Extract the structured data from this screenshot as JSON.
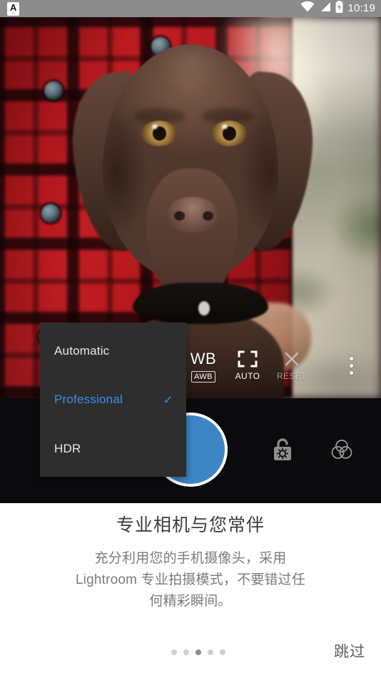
{
  "statusbar": {
    "app_badge_letter": "A",
    "app_badge_sub": "Lr",
    "clock": "10:19",
    "icons": [
      "wifi-icon",
      "cellular-signal-icon",
      "battery-charging-icon"
    ],
    "background_color": "#8c8c8c"
  },
  "camera": {
    "controls": [
      {
        "id": "wb",
        "main": "WB",
        "sub": "AWB",
        "sub_style": "badge",
        "dimmed": false
      },
      {
        "id": "focus",
        "main": "focus-frame-icon",
        "sub": "AUTO",
        "sub_style": "plain",
        "dimmed": false
      },
      {
        "id": "reset",
        "main": "close-x-icon",
        "sub": "RESET",
        "sub_style": "plain",
        "dimmed": true
      }
    ],
    "overflow_menu": "more-options-icon",
    "shutter": {
      "label": "shutter-button",
      "color": "#3d86c6",
      "ring_color": "#ffffff"
    },
    "bottom_icons": [
      {
        "id": "ae-lock",
        "name": "ae-lock-unlocked-icon"
      },
      {
        "id": "color-profile",
        "name": "color-circles-icon"
      }
    ],
    "bar_color": "#0b0b0e"
  },
  "mode_menu": {
    "accent_color": "#3b8ede",
    "background_color": "#2e2e2e",
    "check_glyph": "✓",
    "items": [
      {
        "label": "Automatic",
        "selected": false
      },
      {
        "label": "Professional",
        "selected": true
      },
      {
        "label": "HDR",
        "selected": false
      }
    ]
  },
  "onboarding": {
    "title": "专业相机与您常伴",
    "body": "充分利用您的手机摄像头，采用 Lightroom 专业拍摄模式，不要错过任何精彩瞬间。",
    "skip_label": "跳过",
    "page_dots": {
      "total": 5,
      "active_index": 2
    }
  },
  "photo": {
    "description": "chocolate-labrador-puppy-photo"
  }
}
